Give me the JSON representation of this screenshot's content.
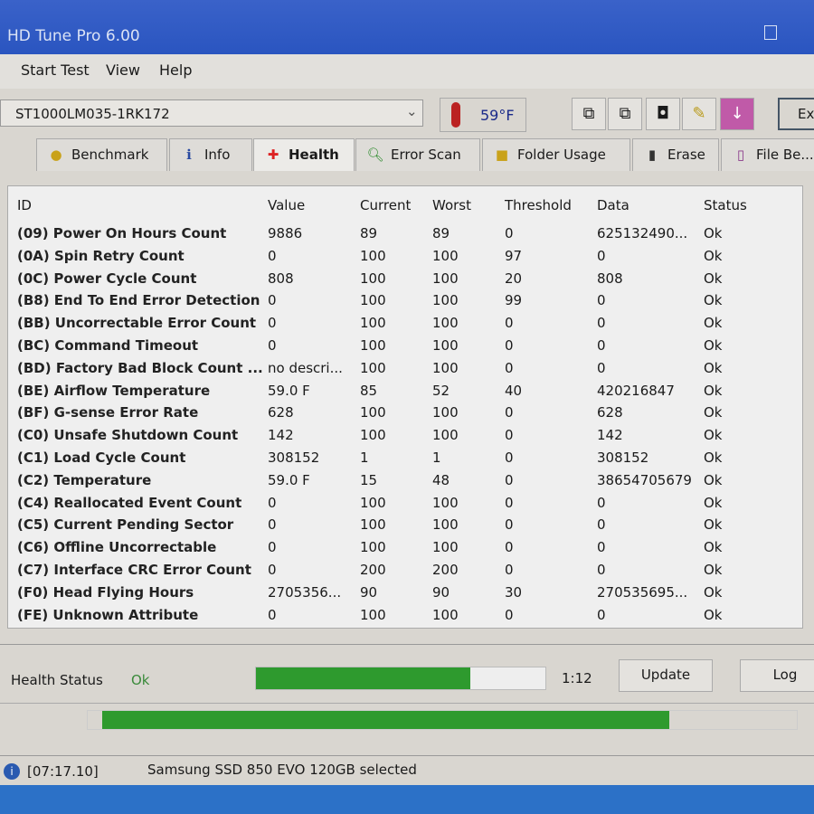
{
  "window": {
    "title": "HD Tune Pro 6.00"
  },
  "menu": [
    "Start Test",
    "View",
    "Help"
  ],
  "toolbar": {
    "drive": "ST1000LM035-1RK172",
    "temperature": "59°F",
    "exit_label": "Ex"
  },
  "tabs": [
    {
      "label": "Benchmark",
      "icon": "lightbulb-icon"
    },
    {
      "label": "Info",
      "icon": "info-icon"
    },
    {
      "label": "Health",
      "icon": "red-cross-icon",
      "active": true
    },
    {
      "label": "Error Scan",
      "icon": "magnifier-icon"
    },
    {
      "label": "Folder Usage",
      "icon": "folder-icon"
    },
    {
      "label": "Erase",
      "icon": "trash-icon"
    },
    {
      "label": "File Be...",
      "icon": "file-benchmark-icon"
    }
  ],
  "table": {
    "headers": [
      "ID",
      "Value",
      "Current",
      "Worst",
      "Threshold",
      "Data",
      "Status"
    ],
    "rows": [
      [
        "(09) Power On Hours Count",
        "9886",
        "89",
        "89",
        "0",
        "625132490...",
        "Ok"
      ],
      [
        "(0A) Spin Retry Count",
        "0",
        "100",
        "100",
        "97",
        "0",
        "Ok"
      ],
      [
        "(0C) Power Cycle Count",
        "808",
        "100",
        "100",
        "20",
        "808",
        "Ok"
      ],
      [
        "(B8) End To End Error Detection",
        "0",
        "100",
        "100",
        "99",
        "0",
        "Ok"
      ],
      [
        "(BB) Uncorrectable Error Count",
        "0",
        "100",
        "100",
        "0",
        "0",
        "Ok"
      ],
      [
        "(BC) Command Timeout",
        "0",
        "100",
        "100",
        "0",
        "0",
        "Ok"
      ],
      [
        "(BD) Factory Bad Block Count ...",
        "no descri...",
        "100",
        "100",
        "0",
        "0",
        "Ok"
      ],
      [
        "(BE) Airflow Temperature",
        "59.0 F",
        "85",
        "52",
        "40",
        "420216847",
        "Ok"
      ],
      [
        "(BF) G-sense Error Rate",
        "628",
        "100",
        "100",
        "0",
        "628",
        "Ok"
      ],
      [
        "(C0) Unsafe Shutdown Count",
        "142",
        "100",
        "100",
        "0",
        "142",
        "Ok"
      ],
      [
        "(C1) Load Cycle Count",
        "308152",
        "1",
        "1",
        "0",
        "308152",
        "Ok"
      ],
      [
        "(C2) Temperature",
        "59.0 F",
        "15",
        "48",
        "0",
        "38654705679",
        "Ok"
      ],
      [
        "(C4) Reallocated Event Count",
        "0",
        "100",
        "100",
        "0",
        "0",
        "Ok"
      ],
      [
        "(C5) Current Pending Sector",
        "0",
        "100",
        "100",
        "0",
        "0",
        "Ok"
      ],
      [
        "(C6) Offline Uncorrectable",
        "0",
        "100",
        "100",
        "0",
        "0",
        "Ok"
      ],
      [
        "(C7) Interface CRC Error Count",
        "0",
        "200",
        "200",
        "0",
        "0",
        "Ok"
      ],
      [
        "(F0) Head Flying Hours",
        "2705356...",
        "90",
        "90",
        "30",
        "270535695...",
        "Ok"
      ],
      [
        "(FE) Unknown Attribute",
        "0",
        "100",
        "100",
        "0",
        "0",
        "Ok"
      ]
    ]
  },
  "health": {
    "label": "Health Status",
    "value": "Ok",
    "progress": 0.74,
    "time": "1:12",
    "update_label": "Update",
    "log_label": "Log",
    "progress2": 0.8
  },
  "statusbar": {
    "time": "[07:17.10]",
    "message": "Samsung SSD 850 EVO 120GB selected"
  },
  "colors": {
    "progress": "#2e9a2e",
    "titlebar": "#2a55c0"
  }
}
